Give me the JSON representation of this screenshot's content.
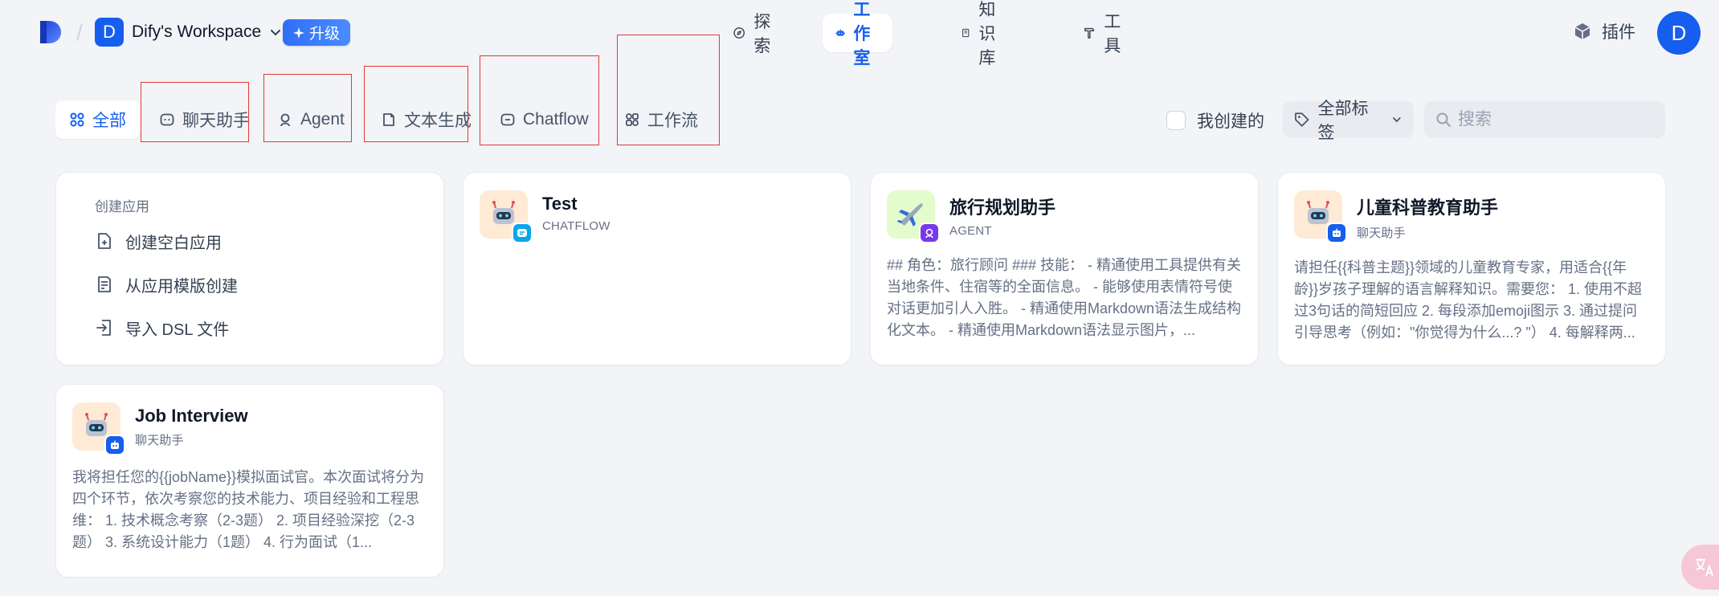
{
  "workspace": {
    "avatar_letter": "D",
    "name": "Dify's Workspace",
    "upgrade_label": "升级"
  },
  "nav": [
    {
      "label": "探索",
      "icon": "compass-icon"
    },
    {
      "label": "工作室",
      "icon": "robot-icon",
      "active": true
    },
    {
      "label": "知识库",
      "icon": "book-icon"
    },
    {
      "label": "工具",
      "icon": "hammer-icon"
    }
  ],
  "header": {
    "plugins_label": "插件",
    "user_avatar_letter": "D"
  },
  "filters": {
    "tabs": [
      {
        "label": "全部",
        "icon": "grid-icon",
        "active": true
      },
      {
        "label": "聊天助手",
        "icon": "chat-icon"
      },
      {
        "label": "Agent",
        "icon": "agent-icon"
      },
      {
        "label": "文本生成",
        "icon": "document-icon"
      },
      {
        "label": "Chatflow",
        "icon": "chatflow-icon"
      },
      {
        "label": "工作流",
        "icon": "workflow-icon"
      }
    ],
    "created_by_me_label": "我创建的",
    "tags_label": "全部标签",
    "search_placeholder": "搜索"
  },
  "create": {
    "title": "创建应用",
    "items": [
      {
        "label": "创建空白应用",
        "icon": "file-plus-icon"
      },
      {
        "label": "从应用模版创建",
        "icon": "template-icon"
      },
      {
        "label": "导入 DSL 文件",
        "icon": "import-icon"
      }
    ]
  },
  "apps": [
    {
      "name": "Test",
      "type": "CHATFLOW",
      "description": "",
      "icon": "robot-emoji-icon",
      "badge": "chatflow-badge-icon",
      "badge_color": "#0ba5ec",
      "icon_bg": "#ffead5"
    },
    {
      "name": "旅行规划助手",
      "type": "AGENT",
      "description": "## 角色：旅行顾问 ### 技能： - 精通使用工具提供有关当地条件、住宿等的全面信息。 - 能够使用表情符号使对话更加引人入胜。 - 精通使用Markdown语法生成结构化文本。 - 精通使用Markdown语法显示图片，...",
      "icon": "airplane-emoji-icon",
      "badge": "agent-badge-icon",
      "badge_color": "#7839ee",
      "icon_bg": "#e4fbcc"
    },
    {
      "name": "儿童科普教育助手",
      "type": "聊天助手",
      "description": "请担任{{科普主题}}领域的儿童教育专家，用适合{{年龄}}岁孩子理解的语言解释知识。需要您： 1. 使用不超过3句话的简短回应 2. 每段添加emoji图示 3. 通过提问引导思考（例如：\"你觉得为什么...? \"） 4. 每解释两...",
      "icon": "robot-emoji-icon",
      "badge": "chatbot-badge-icon",
      "badge_color": "#155eef",
      "icon_bg": "#ffead5"
    },
    {
      "name": "Job Interview",
      "type": "聊天助手",
      "description": "我将担任您的{{jobName}}模拟面试官。本次面试将分为四个环节，依次考察您的技术能力、项目经验和工程思维： 1. 技术概念考察（2-3题） 2. 项目经验深挖（2-3题） 3. 系统设计能力（1题） 4. 行为面试（1...",
      "icon": "robot-emoji-icon",
      "badge": "chatbot-badge-icon",
      "badge_color": "#155eef",
      "icon_bg": "#ffead5"
    }
  ],
  "colors": {
    "accent": "#155eef",
    "background": "#f2f4f7",
    "highlight_box": "#e53935"
  }
}
